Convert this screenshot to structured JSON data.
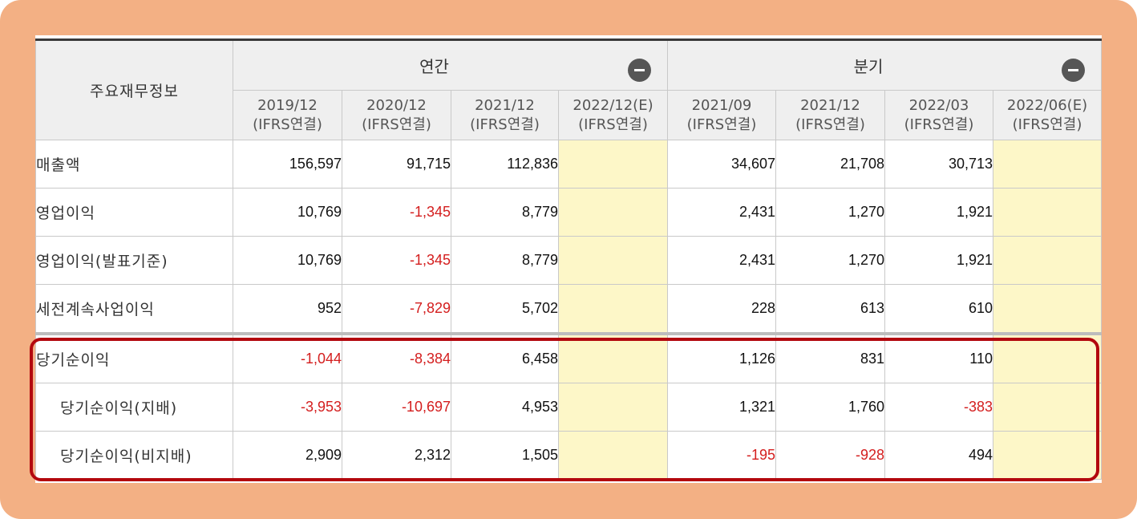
{
  "table": {
    "corner_label": "주요재무정보",
    "groups": [
      {
        "label": "연간",
        "collapse_label": "−"
      },
      {
        "label": "분기",
        "collapse_label": "−"
      }
    ],
    "periods": [
      {
        "period": "2019/12",
        "basis": "(IFRS연결)"
      },
      {
        "period": "2020/12",
        "basis": "(IFRS연결)"
      },
      {
        "period": "2021/12",
        "basis": "(IFRS연결)"
      },
      {
        "period": "2022/12(E)",
        "basis": "(IFRS연결)"
      },
      {
        "period": "2021/09",
        "basis": "(IFRS연결)"
      },
      {
        "period": "2021/12",
        "basis": "(IFRS연결)"
      },
      {
        "period": "2022/03",
        "basis": "(IFRS연결)"
      },
      {
        "period": "2022/06(E)",
        "basis": "(IFRS연결)"
      }
    ],
    "rows": [
      {
        "label": "매출액",
        "values": [
          "156,597",
          "91,715",
          "112,836",
          "",
          "34,607",
          "21,708",
          "30,713",
          ""
        ]
      },
      {
        "label": "영업이익",
        "values": [
          "10,769",
          "-1,345",
          "8,779",
          "",
          "2,431",
          "1,270",
          "1,921",
          ""
        ]
      },
      {
        "label": "영업이익(발표기준)",
        "values": [
          "10,769",
          "-1,345",
          "8,779",
          "",
          "2,431",
          "1,270",
          "1,921",
          ""
        ]
      },
      {
        "label": "세전계속사업이익",
        "values": [
          "952",
          "-7,829",
          "5,702",
          "",
          "228",
          "613",
          "610",
          ""
        ]
      },
      {
        "label": "당기순이익",
        "values": [
          "-1,044",
          "-8,384",
          "6,458",
          "",
          "1,126",
          "831",
          "110",
          ""
        ]
      },
      {
        "label": "당기순이익(지배)",
        "values": [
          "-3,953",
          "-10,697",
          "4,953",
          "",
          "1,321",
          "1,760",
          "-383",
          ""
        ]
      },
      {
        "label": "당기순이익(비지배)",
        "values": [
          "2,909",
          "2,312",
          "1,505",
          "",
          "-195",
          "-928",
          "494",
          ""
        ]
      }
    ]
  },
  "colors": {
    "frame_background": "#f3b084",
    "header_background": "#efefef",
    "estimate_cell": "#fdf7c8",
    "negative_value": "#d41e1e",
    "highlight_border": "#b3080e"
  }
}
